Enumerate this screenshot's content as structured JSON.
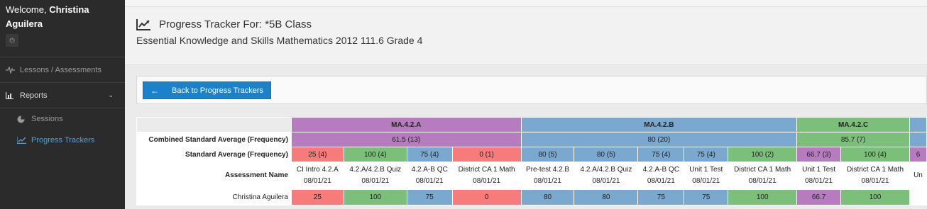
{
  "sidebar": {
    "welcome_prefix": "Welcome,",
    "user_name": "Christina Aguilera",
    "items": [
      {
        "label": "Lessons / Assessments",
        "icon": "pulse-icon"
      },
      {
        "label": "Reports",
        "icon": "bar-chart-icon"
      }
    ],
    "sub_items": [
      {
        "label": "Sessions",
        "icon": "pie-chart-icon"
      },
      {
        "label": "Progress Trackers",
        "icon": "line-chart-icon",
        "active": true
      }
    ]
  },
  "header": {
    "title": "Progress Tracker For: *5B Class",
    "subtitle": "Essential Knowledge and Skills Mathematics 2012 111.6 Grade 4"
  },
  "toolbar": {
    "back_label": "Back to Progress Trackers"
  },
  "colors": {
    "purple": "#b77bbf",
    "blue": "#7aa8cf",
    "green": "#7bbf7b",
    "red": "#f77b7b",
    "sidebar_bg": "#2b2b2b",
    "button_blue": "#1b82c9"
  },
  "table": {
    "row_labels": {
      "combined": "Combined Standard Average (Frequency)",
      "standard": "Standard Average (Frequency)",
      "assessment": "Assessment Name"
    },
    "standards": [
      {
        "code": "MA.4.2.A",
        "combined": "61.5 (13)",
        "color": "purple"
      },
      {
        "code": "MA.4.2.B",
        "combined": "80 (20)",
        "color": "blue"
      },
      {
        "code": "MA.4.2.C",
        "combined": "85.7 (7)",
        "color": "green"
      },
      {
        "code": "",
        "combined": "",
        "color": "blue"
      }
    ],
    "assessments": [
      {
        "std": "25 (4)",
        "std_color": "red",
        "name": "CI Intro 4.2.A",
        "date": "08/01/21",
        "score": "25",
        "score_color": "red"
      },
      {
        "std": "100 (4)",
        "std_color": "green",
        "name": "4.2.A/4.2.B Quiz",
        "date": "08/01/21",
        "score": "100",
        "score_color": "green"
      },
      {
        "std": "75 (4)",
        "std_color": "blue",
        "name": "4.2.A-B QC",
        "date": "08/01/21",
        "score": "75",
        "score_color": "blue"
      },
      {
        "std": "0 (1)",
        "std_color": "red",
        "name": "District CA 1 Math",
        "date": "08/01/21",
        "score": "0",
        "score_color": "red"
      },
      {
        "std": "80 (5)",
        "std_color": "blue",
        "name": "Pre-test 4.2.B",
        "date": "08/01/21",
        "score": "80",
        "score_color": "blue"
      },
      {
        "std": "80 (5)",
        "std_color": "blue",
        "name": "4.2.A/4.2.B Quiz",
        "date": "08/01/21",
        "score": "80",
        "score_color": "blue"
      },
      {
        "std": "75 (4)",
        "std_color": "blue",
        "name": "4.2.A-B QC",
        "date": "08/01/21",
        "score": "75",
        "score_color": "blue"
      },
      {
        "std": "75 (4)",
        "std_color": "blue",
        "name": "Unit 1 Test",
        "date": "08/01/21",
        "score": "75",
        "score_color": "blue"
      },
      {
        "std": "100 (2)",
        "std_color": "green",
        "name": "District CA 1 Math",
        "date": "08/01/21",
        "score": "100",
        "score_color": "green"
      },
      {
        "std": "66.7 (3)",
        "std_color": "purple",
        "name": "Unit 1 Test",
        "date": "08/01/21",
        "score": "66.7",
        "score_color": "purple"
      },
      {
        "std": "100 (4)",
        "std_color": "green",
        "name": "District CA 1 Math",
        "date": "08/01/21",
        "score": "100",
        "score_color": "green"
      },
      {
        "std": "6",
        "std_color": "purple",
        "name": "Un",
        "date": "",
        "score": "",
        "score_color": "white"
      }
    ],
    "student": "Christina Aguilera"
  }
}
